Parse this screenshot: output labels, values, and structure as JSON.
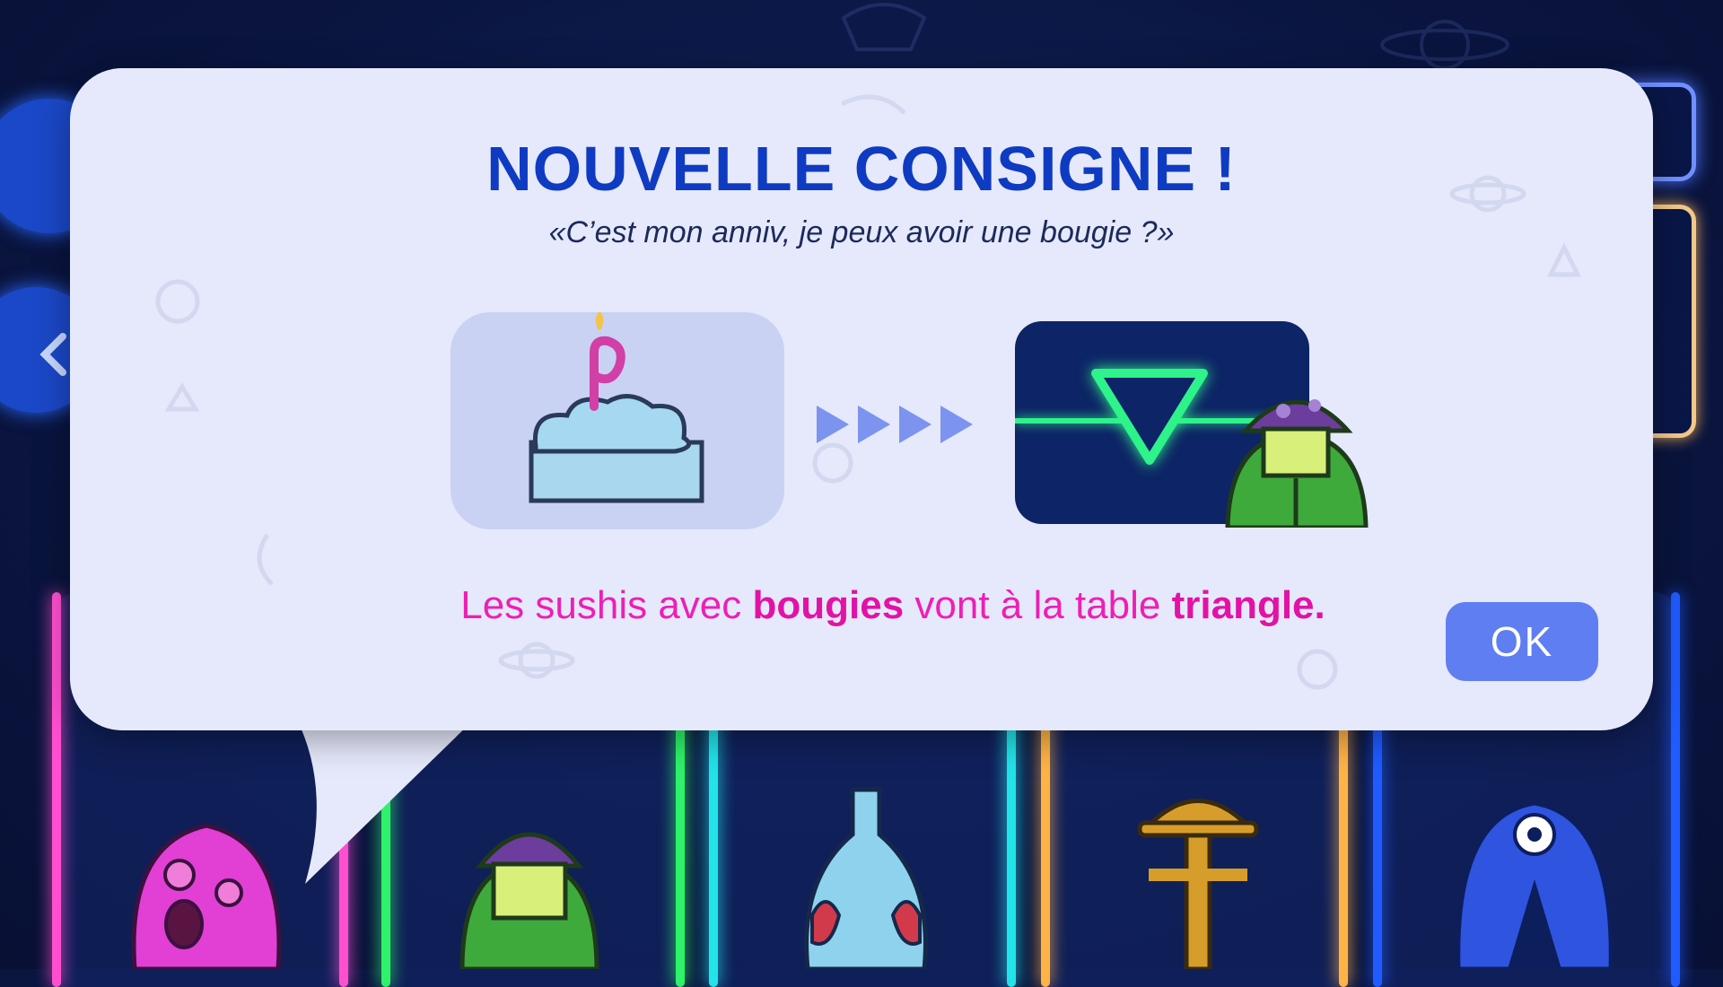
{
  "dialog": {
    "title": "NOUVELLE CONSIGNE !",
    "quote": "«C’est mon anniv, je peux avoir une bougie ?»",
    "instruction": {
      "prefix": "Les sushis avec ",
      "keyword1": "bougies",
      "middle": " vont à la table ",
      "keyword2": "triangle."
    },
    "ok_label": "OK",
    "from_icon": "cake-with-candle-icon",
    "to_icon": "triangle-table-icon",
    "arrow_icon": "four-arrows-icon"
  },
  "colors": {
    "title": "#0f3bc2",
    "instruction": "#ee1fb5",
    "ok_button": "#5f7ef2",
    "dialog_bg": "#e5e9fb",
    "neon_green": "#2ef28a",
    "lane_pink": "#ff4fd0",
    "lane_green": "#2ef26a",
    "lane_cyan": "#22e3e8",
    "lane_orange": "#ffb347",
    "lane_blue": "#1f5bff"
  }
}
